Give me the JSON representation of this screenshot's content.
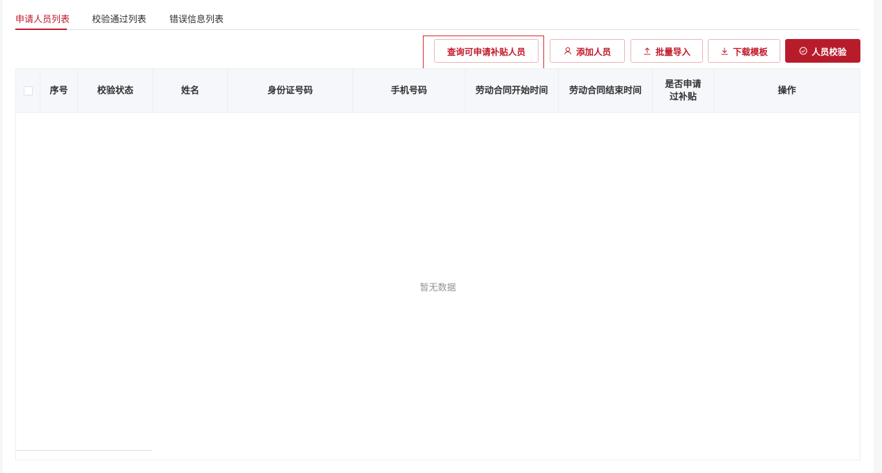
{
  "tabs": [
    {
      "label": "申请人员列表",
      "active": true
    },
    {
      "label": "校验通过列表",
      "active": false
    },
    {
      "label": "错误信息列表",
      "active": false
    }
  ],
  "toolbar": {
    "query_label": "查询可申请补贴人员",
    "add_label": "添加人员",
    "import_label": "批量导入",
    "download_label": "下载模板",
    "verify_label": "人员校验"
  },
  "icons": {
    "add": "user-icon",
    "import": "upload-icon",
    "download": "download-icon",
    "verify": "check-circle-icon"
  },
  "table": {
    "columns": [
      "序号",
      "校验状态",
      "姓名",
      "身份证号码",
      "手机号码",
      "劳动合同开始时间",
      "劳动合同结束时间",
      "是否申请过补贴",
      "操作"
    ],
    "rows": [],
    "empty_text": "暂无数据"
  },
  "colors": {
    "accent": "#c0192a",
    "primary_button": "#b81c2b",
    "highlight_box": "#e02424"
  }
}
